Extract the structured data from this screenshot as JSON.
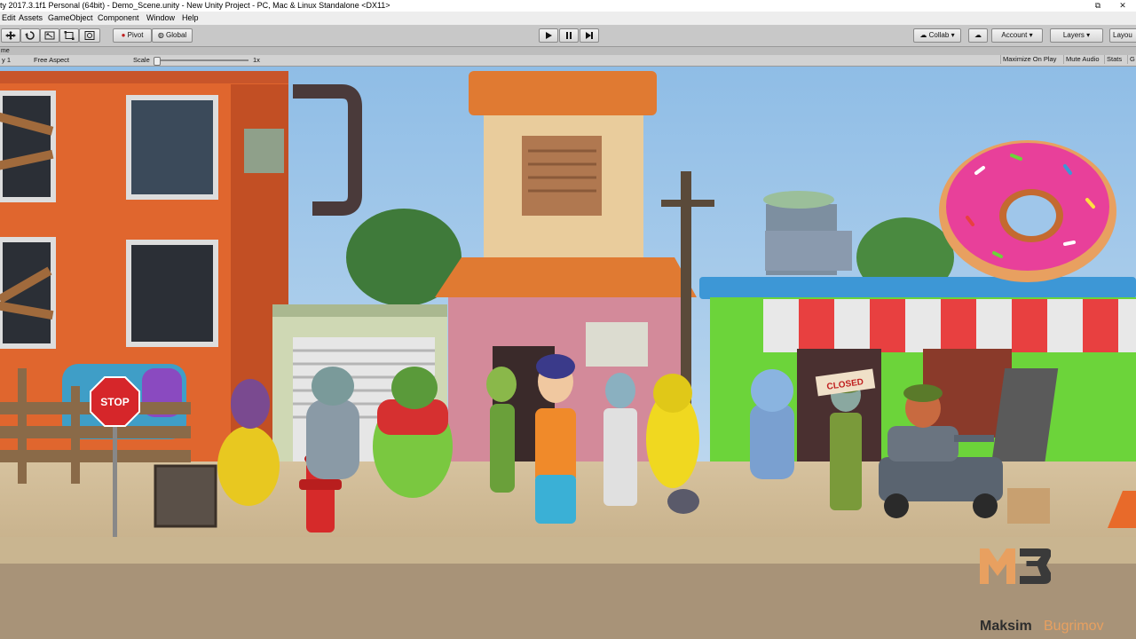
{
  "window": {
    "title": "ty 2017.3.1f1 Personal (64bit) - Demo_Scene.unity - New Unity Project - PC, Mac & Linux Standalone <DX11>"
  },
  "menu": [
    "Edit",
    "Assets",
    "GameObject",
    "Component",
    "Window",
    "Help"
  ],
  "toolbar": {
    "pivot_label": "Pivot",
    "global_label": "Global",
    "collab_label": "Collab",
    "account_label": "Account",
    "layers_label": "Layers",
    "layout_label": "Layou"
  },
  "tab": {
    "label": "me"
  },
  "game_view": {
    "display_label": "y 1",
    "aspect_label": "Free Aspect",
    "scale_label": "Scale",
    "scale_value": "1x",
    "maximize_label": "Maximize On Play",
    "mute_label": "Mute Audio",
    "stats_label": "Stats",
    "gizmos_label": "G"
  },
  "scene": {
    "sign_text": "STOP",
    "closed_sign": "CLOSED"
  },
  "watermark": {
    "first": "Maksim",
    "last": "Bugrimov"
  },
  "colors": {
    "sky": "#9fc6ea",
    "orange_building": "#e0662e",
    "green_shop": "#6cd43a",
    "donut_glaze": "#e8409a",
    "logo_accent": "#e8a060"
  }
}
